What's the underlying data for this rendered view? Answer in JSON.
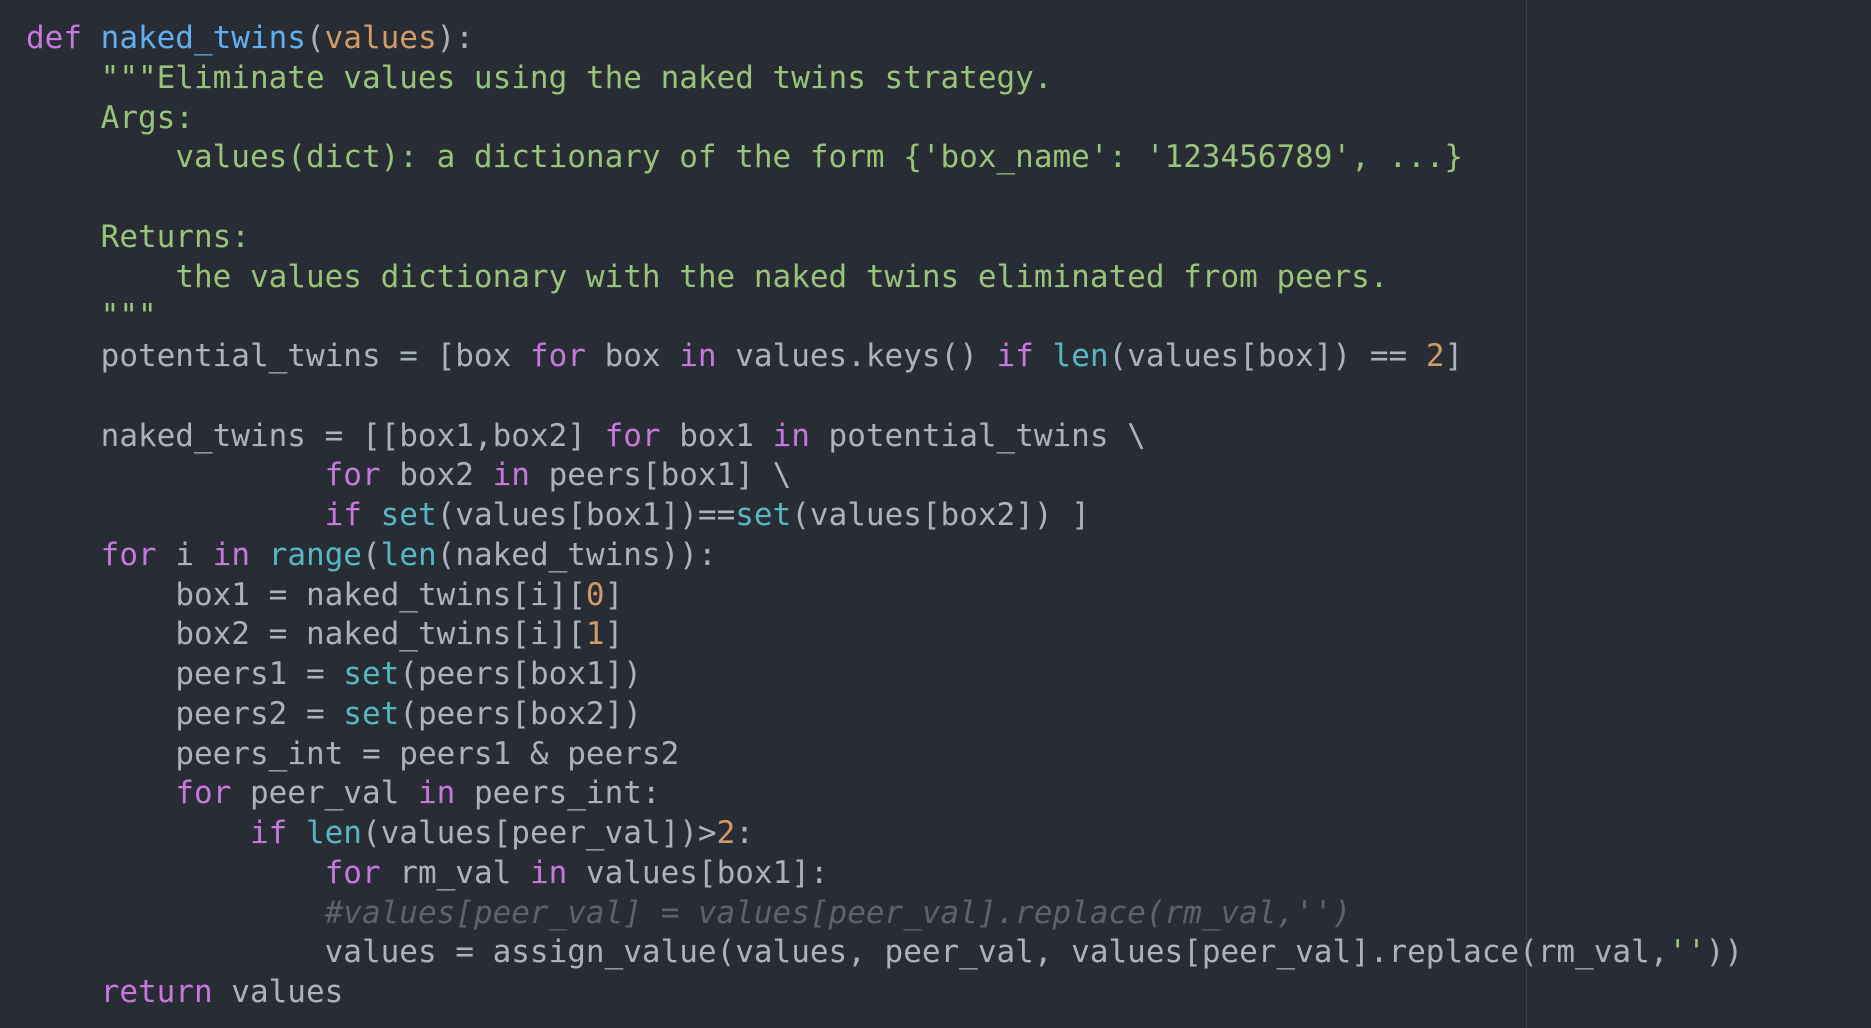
{
  "colors": {
    "background": "#282c34",
    "keyword": "#c678dd",
    "function": "#61afef",
    "parameter": "#d19a66",
    "string": "#98c379",
    "builtin": "#56b6c2",
    "number": "#d19a66",
    "comment": "#5c6370",
    "text": "#abb2bf"
  },
  "lines": [
    {
      "indent": 0,
      "tokens": [
        {
          "t": "def ",
          "k": "k"
        },
        {
          "t": "naked_twins",
          "k": "f"
        },
        {
          "t": "(",
          "k": "t"
        },
        {
          "t": "values",
          "k": "p"
        },
        {
          "t": "):",
          "k": "t"
        }
      ]
    },
    {
      "indent": 4,
      "tokens": [
        {
          "t": "\"\"\"Eliminate values using the naked twins strategy.",
          "k": "s"
        }
      ]
    },
    {
      "indent": 4,
      "tokens": [
        {
          "t": "Args:",
          "k": "s"
        }
      ]
    },
    {
      "indent": 8,
      "tokens": [
        {
          "t": "values(dict): a dictionary of the form {'box_name': '123456789', ...}",
          "k": "s"
        }
      ]
    },
    {
      "indent": 0,
      "tokens": []
    },
    {
      "indent": 4,
      "tokens": [
        {
          "t": "Returns:",
          "k": "s"
        }
      ]
    },
    {
      "indent": 8,
      "tokens": [
        {
          "t": "the values dictionary with the naked twins eliminated from peers.",
          "k": "s"
        }
      ]
    },
    {
      "indent": 4,
      "tokens": [
        {
          "t": "\"\"\"",
          "k": "s"
        }
      ]
    },
    {
      "indent": 4,
      "tokens": [
        {
          "t": "potential_twins = [box ",
          "k": "t"
        },
        {
          "t": "for",
          "k": "k"
        },
        {
          "t": " box ",
          "k": "t"
        },
        {
          "t": "in",
          "k": "k"
        },
        {
          "t": " values.keys() ",
          "k": "t"
        },
        {
          "t": "if",
          "k": "k"
        },
        {
          "t": " ",
          "k": "t"
        },
        {
          "t": "len",
          "k": "b"
        },
        {
          "t": "(values[box]) == ",
          "k": "t"
        },
        {
          "t": "2",
          "k": "n"
        },
        {
          "t": "]",
          "k": "t"
        }
      ]
    },
    {
      "indent": 0,
      "tokens": []
    },
    {
      "indent": 4,
      "tokens": [
        {
          "t": "naked_twins = [[box1,box2] ",
          "k": "t"
        },
        {
          "t": "for",
          "k": "k"
        },
        {
          "t": " box1 ",
          "k": "t"
        },
        {
          "t": "in",
          "k": "k"
        },
        {
          "t": " potential_twins \\",
          "k": "t"
        }
      ]
    },
    {
      "indent": 16,
      "tokens": [
        {
          "t": "for",
          "k": "k"
        },
        {
          "t": " box2 ",
          "k": "t"
        },
        {
          "t": "in",
          "k": "k"
        },
        {
          "t": " peers[box1] \\",
          "k": "t"
        }
      ]
    },
    {
      "indent": 16,
      "tokens": [
        {
          "t": "if",
          "k": "k"
        },
        {
          "t": " ",
          "k": "t"
        },
        {
          "t": "set",
          "k": "b"
        },
        {
          "t": "(values[box1])==",
          "k": "t"
        },
        {
          "t": "set",
          "k": "b"
        },
        {
          "t": "(values[box2]) ]",
          "k": "t"
        }
      ]
    },
    {
      "indent": 4,
      "tokens": [
        {
          "t": "for",
          "k": "k"
        },
        {
          "t": " i ",
          "k": "t"
        },
        {
          "t": "in",
          "k": "k"
        },
        {
          "t": " ",
          "k": "t"
        },
        {
          "t": "range",
          "k": "b"
        },
        {
          "t": "(",
          "k": "t"
        },
        {
          "t": "len",
          "k": "b"
        },
        {
          "t": "(naked_twins)):",
          "k": "t"
        }
      ]
    },
    {
      "indent": 8,
      "tokens": [
        {
          "t": "box1 = naked_twins[i][",
          "k": "t"
        },
        {
          "t": "0",
          "k": "n"
        },
        {
          "t": "]",
          "k": "t"
        }
      ]
    },
    {
      "indent": 8,
      "tokens": [
        {
          "t": "box2 = naked_twins[i][",
          "k": "t"
        },
        {
          "t": "1",
          "k": "n"
        },
        {
          "t": "]",
          "k": "t"
        }
      ]
    },
    {
      "indent": 8,
      "tokens": [
        {
          "t": "peers1 = ",
          "k": "t"
        },
        {
          "t": "set",
          "k": "b"
        },
        {
          "t": "(peers[box1])",
          "k": "t"
        }
      ]
    },
    {
      "indent": 8,
      "tokens": [
        {
          "t": "peers2 = ",
          "k": "t"
        },
        {
          "t": "set",
          "k": "b"
        },
        {
          "t": "(peers[box2])",
          "k": "t"
        }
      ]
    },
    {
      "indent": 8,
      "tokens": [
        {
          "t": "peers_int = peers1 & peers2",
          "k": "t"
        }
      ]
    },
    {
      "indent": 8,
      "tokens": [
        {
          "t": "for",
          "k": "k"
        },
        {
          "t": " peer_val ",
          "k": "t"
        },
        {
          "t": "in",
          "k": "k"
        },
        {
          "t": " peers_int:",
          "k": "t"
        }
      ]
    },
    {
      "indent": 12,
      "tokens": [
        {
          "t": "if",
          "k": "k"
        },
        {
          "t": " ",
          "k": "t"
        },
        {
          "t": "len",
          "k": "b"
        },
        {
          "t": "(values[peer_val])>",
          "k": "t"
        },
        {
          "t": "2",
          "k": "n"
        },
        {
          "t": ":",
          "k": "t"
        }
      ]
    },
    {
      "indent": 16,
      "tokens": [
        {
          "t": "for",
          "k": "k"
        },
        {
          "t": " rm_val ",
          "k": "t"
        },
        {
          "t": "in",
          "k": "k"
        },
        {
          "t": " values[box1]:",
          "k": "t"
        }
      ]
    },
    {
      "indent": 16,
      "tokens": [
        {
          "t": "#values[peer_val] = values[peer_val].replace(rm_val,'')",
          "k": "c"
        }
      ]
    },
    {
      "indent": 16,
      "tokens": [
        {
          "t": "values = assign_value(values, peer_val, values[peer_val].replace(rm_val,",
          "k": "t"
        },
        {
          "t": "''",
          "k": "s"
        },
        {
          "t": "))",
          "k": "t"
        }
      ]
    },
    {
      "indent": 4,
      "tokens": [
        {
          "t": "return",
          "k": "k"
        },
        {
          "t": " values",
          "k": "t"
        }
      ]
    }
  ]
}
